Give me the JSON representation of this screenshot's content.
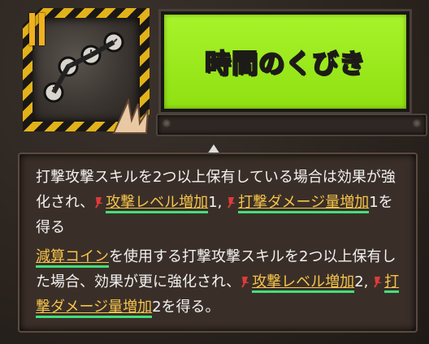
{
  "skill": {
    "title": "時間のくびき",
    "rank_symbol": "II"
  },
  "description": {
    "paragraph1": [
      {
        "t": "打撃攻撃スキルを2つ以上保有している場合は効果が強化され、"
      },
      {
        "icon": "pin-icon"
      },
      {
        "t": "攻撃レベル増加",
        "link": true
      },
      {
        "t": "1, "
      },
      {
        "icon": "pin-icon"
      },
      {
        "t": "打撃ダメージ量増加",
        "link": true
      },
      {
        "t": "1を得る"
      }
    ],
    "paragraph2": [
      {
        "t": "減算コイン",
        "link": true
      },
      {
        "t": "を使用する打撃攻撃スキルを2つ以上保有した場合、効果が更に強化され、"
      },
      {
        "icon": "pin-icon"
      },
      {
        "t": "攻撃レベル増加",
        "link": true
      },
      {
        "t": "2, "
      },
      {
        "icon": "pin-icon"
      },
      {
        "t": "打撃ダメージ量増加",
        "link": true
      },
      {
        "t": "2を得る。"
      }
    ]
  },
  "colors": {
    "accent": "#9ef01f",
    "hazard": "#e2b21a",
    "link": "#f6c34a",
    "underline": "#41e07a",
    "pin": "#e03a3a"
  }
}
